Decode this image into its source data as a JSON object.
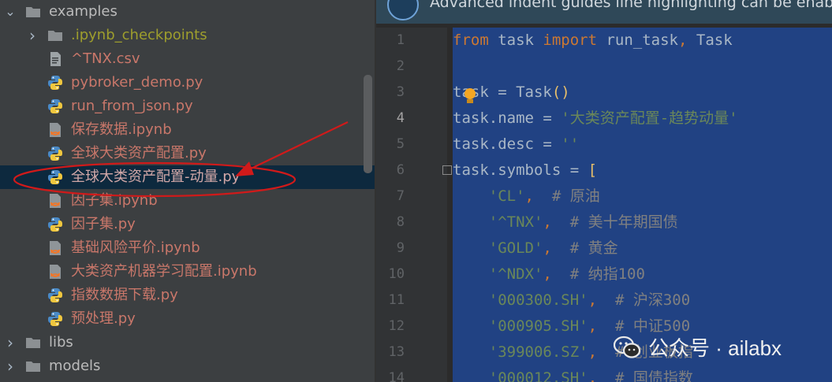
{
  "project_tree": {
    "items": [
      {
        "label": "examples",
        "type": "folder",
        "expanded": true,
        "style": "dir"
      },
      {
        "label": ".ipynb_checkpoints",
        "type": "folder",
        "expanded": false,
        "style": "ignored"
      },
      {
        "label": "^TNX.csv",
        "type": "csv-file",
        "style": "mod"
      },
      {
        "label": "pybroker_demo.py",
        "type": "python-file",
        "style": "mod"
      },
      {
        "label": "run_from_json.py",
        "type": "python-file",
        "style": "mod"
      },
      {
        "label": "保存数据.ipynb",
        "type": "notebook-file",
        "style": "mod"
      },
      {
        "label": "全球大类资产配置.py",
        "type": "python-file",
        "style": "mod"
      },
      {
        "label": "全球大类资产配置-动量.py",
        "type": "python-file",
        "style": "norm",
        "selected": true
      },
      {
        "label": "因子集.ipynb",
        "type": "notebook-file",
        "style": "mod"
      },
      {
        "label": "因子集.py",
        "type": "python-file",
        "style": "mod"
      },
      {
        "label": "基础风险平价.ipynb",
        "type": "notebook-file",
        "style": "mod"
      },
      {
        "label": "大类资产机器学习配置.ipynb",
        "type": "notebook-file",
        "style": "mod"
      },
      {
        "label": "指数数据下载.py",
        "type": "python-file",
        "style": "mod"
      },
      {
        "label": "预处理.py",
        "type": "python-file",
        "style": "mod"
      },
      {
        "label": "libs",
        "type": "folder",
        "expanded": false,
        "style": "dir"
      },
      {
        "label": "models",
        "type": "folder",
        "expanded": false,
        "style": "dir"
      }
    ]
  },
  "editor": {
    "banner_text": "Advanced indent guides line highlighting can be enabled fo",
    "active_line": 4,
    "lines": [
      {
        "n": "1",
        "tokens": [
          {
            "t": "from",
            "c": "kw"
          },
          {
            "t": " task ",
            "c": ""
          },
          {
            "t": "import",
            "c": "kw"
          },
          {
            "t": " run_task",
            "c": ""
          },
          {
            "t": ",",
            "c": "kw"
          },
          {
            "t": " Task",
            "c": ""
          }
        ]
      },
      {
        "n": "2",
        "tokens": []
      },
      {
        "n": "3",
        "tokens": [
          {
            "t": "task = Task",
            "c": ""
          },
          {
            "t": "()",
            "c": "paren"
          }
        ]
      },
      {
        "n": "4",
        "tokens": [
          {
            "t": "task.name = ",
            "c": ""
          },
          {
            "t": "'大类资产配置-趋势动量'",
            "c": "str"
          }
        ]
      },
      {
        "n": "5",
        "tokens": [
          {
            "t": "task.desc = ",
            "c": ""
          },
          {
            "t": "''",
            "c": "str"
          }
        ]
      },
      {
        "n": "6",
        "tokens": [
          {
            "t": "task.symbols = ",
            "c": ""
          },
          {
            "t": "[",
            "c": "paren"
          }
        ]
      },
      {
        "n": "7",
        "tokens": [
          {
            "t": "    ",
            "c": ""
          },
          {
            "t": "'CL'",
            "c": "str"
          },
          {
            "t": ",",
            "c": "kw"
          },
          {
            "t": "  # 原油",
            "c": "cmt"
          }
        ]
      },
      {
        "n": "8",
        "tokens": [
          {
            "t": "    ",
            "c": ""
          },
          {
            "t": "'^TNX'",
            "c": "str"
          },
          {
            "t": ",",
            "c": "kw"
          },
          {
            "t": "  # 美十年期国债",
            "c": "cmt"
          }
        ]
      },
      {
        "n": "9",
        "tokens": [
          {
            "t": "    ",
            "c": ""
          },
          {
            "t": "'GOLD'",
            "c": "str"
          },
          {
            "t": ",",
            "c": "kw"
          },
          {
            "t": "  # 黄金",
            "c": "cmt"
          }
        ]
      },
      {
        "n": "10",
        "tokens": [
          {
            "t": "    ",
            "c": ""
          },
          {
            "t": "'^NDX'",
            "c": "str"
          },
          {
            "t": ",",
            "c": "kw"
          },
          {
            "t": "  # 纳指100",
            "c": "cmt"
          }
        ]
      },
      {
        "n": "11",
        "tokens": [
          {
            "t": "    ",
            "c": ""
          },
          {
            "t": "'000300.SH'",
            "c": "str"
          },
          {
            "t": ",",
            "c": "kw"
          },
          {
            "t": "  # 沪深300",
            "c": "cmt"
          }
        ]
      },
      {
        "n": "12",
        "tokens": [
          {
            "t": "    ",
            "c": ""
          },
          {
            "t": "'000905.SH'",
            "c": "str"
          },
          {
            "t": ",",
            "c": "kw"
          },
          {
            "t": "  # 中证500",
            "c": "cmt"
          }
        ]
      },
      {
        "n": "13",
        "tokens": [
          {
            "t": "    ",
            "c": ""
          },
          {
            "t": "'399006.SZ'",
            "c": "str"
          },
          {
            "t": ",",
            "c": "kw"
          },
          {
            "t": "  # 创业板指",
            "c": "cmt"
          }
        ]
      },
      {
        "n": "14",
        "tokens": [
          {
            "t": "    ",
            "c": ""
          },
          {
            "t": "'000012.SH'",
            "c": "str"
          },
          {
            "t": ",",
            "c": "kw"
          },
          {
            "t": "  # 国债指数",
            "c": "cmt"
          }
        ]
      }
    ]
  },
  "watermark": {
    "text": "公众号 · ailabx"
  },
  "colors": {
    "annotation": "#d01a1a",
    "selection": "#214283",
    "tree_bg": "#3c3f41"
  }
}
